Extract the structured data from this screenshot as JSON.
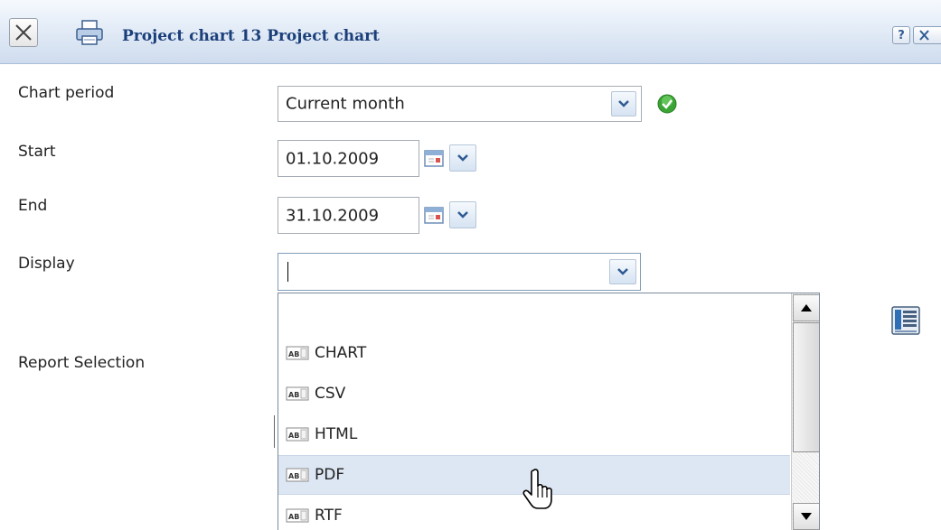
{
  "window": {
    "title": "Project chart 13 Project chart",
    "help_label": "?"
  },
  "form": {
    "chart_period": {
      "label": "Chart period",
      "value": "Current month"
    },
    "start": {
      "label": "Start",
      "value": "01.10.2009"
    },
    "end": {
      "label": "End",
      "value": "31.10.2009"
    },
    "display": {
      "label": "Display",
      "value": ""
    },
    "report_selection": {
      "label": "Report Selection"
    }
  },
  "dropdown": {
    "options": [
      "",
      "CHART",
      "CSV",
      "HTML",
      "PDF",
      "RTF"
    ],
    "hovered": "PDF"
  },
  "colors": {
    "title": "#1b3f7a",
    "accent_green": "#3aa535",
    "hover_row": "#dde7f3"
  },
  "icons": {
    "close": "close-icon",
    "print": "printer-icon",
    "ok": "check-circle-icon",
    "calendar": "calendar-icon",
    "chevron": "chevron-down-icon",
    "option": "text-field-icon",
    "report": "report-list-icon",
    "cursor": "hand-pointer-icon"
  }
}
